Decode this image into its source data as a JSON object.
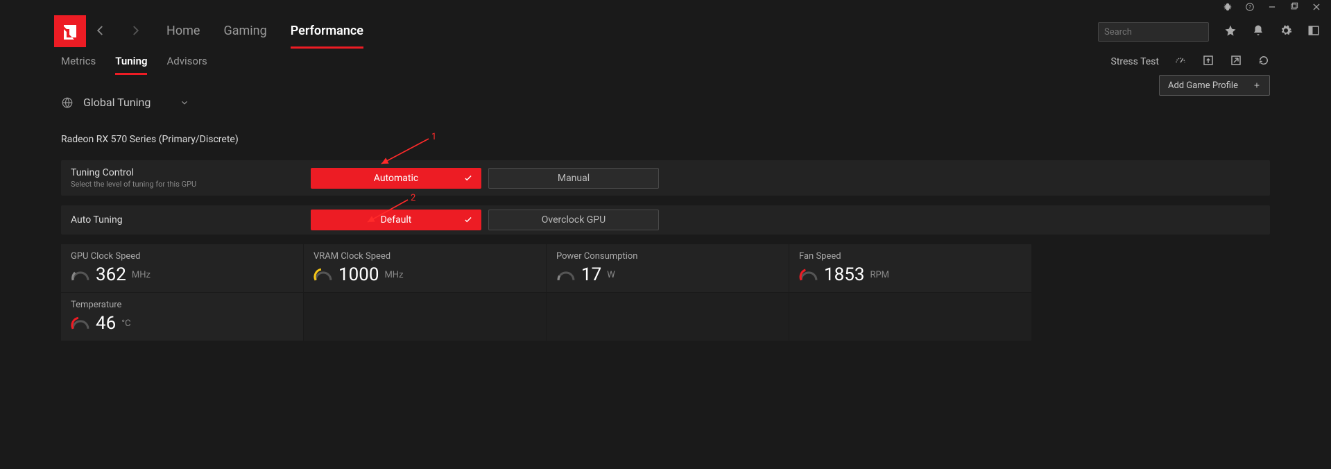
{
  "chrome": {
    "icons": [
      "bug-icon",
      "help-icon",
      "minimize-icon",
      "maximize-icon",
      "close-icon"
    ]
  },
  "header": {
    "nav": {
      "home": "Home",
      "gaming": "Gaming",
      "performance": "Performance"
    },
    "search_placeholder": "Search"
  },
  "subheader": {
    "tabs": {
      "metrics": "Metrics",
      "tuning": "Tuning",
      "advisors": "Advisors"
    },
    "stress_test": "Stress Test"
  },
  "global_tuning": "Global Tuning",
  "add_profile": "Add Game Profile",
  "gpu_name": "Radeon RX 570 Series (Primary/Discrete)",
  "tuning_control": {
    "title": "Tuning Control",
    "subtitle": "Select the level of tuning for this GPU",
    "automatic": "Automatic",
    "manual": "Manual"
  },
  "auto_tuning": {
    "title": "Auto Tuning",
    "default": "Default",
    "overclock": "Overclock GPU"
  },
  "metrics": {
    "gpu_clock": {
      "label": "GPU Clock Speed",
      "value": "362",
      "unit": "MHz"
    },
    "vram_clock": {
      "label": "VRAM Clock Speed",
      "value": "1000",
      "unit": "MHz"
    },
    "power": {
      "label": "Power Consumption",
      "value": "17",
      "unit": "W"
    },
    "fan": {
      "label": "Fan Speed",
      "value": "1853",
      "unit": "RPM"
    },
    "temp": {
      "label": "Temperature",
      "value": "46",
      "unit": "°C"
    }
  },
  "annotations": {
    "a1": "1",
    "a2": "2"
  }
}
